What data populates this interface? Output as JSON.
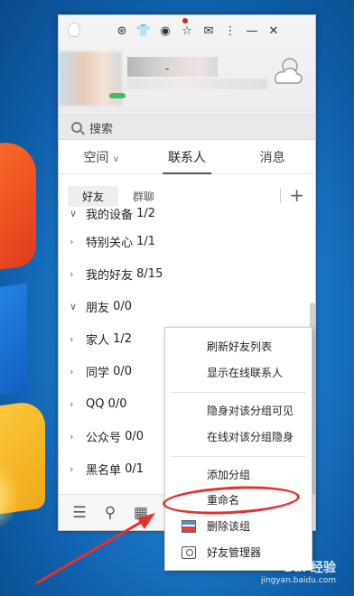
{
  "titlebar": {
    "icons": [
      "qq-logo-icon",
      "skin-icon",
      "shirt-icon",
      "app-icon",
      "star-icon",
      "mail-icon",
      "more-icon",
      "minimize-icon",
      "close-icon"
    ],
    "more_label": "⋮",
    "minimize_label": "—",
    "close_label": "✕"
  },
  "header": {
    "dash": "-"
  },
  "search": {
    "placeholder": "搜索"
  },
  "main_tabs": [
    {
      "label": "空间",
      "dropdown": true
    },
    {
      "label": "联系人",
      "active": true
    },
    {
      "label": "消息"
    }
  ],
  "sub_tabs": [
    {
      "label": "好友",
      "active": true
    },
    {
      "label": "群聊"
    }
  ],
  "add_label": "+",
  "groups": [
    {
      "name": "我的设备",
      "count": "1/2"
    },
    {
      "name": "特别关心",
      "count": "1/1"
    },
    {
      "name": "我的好友",
      "count": "8/15"
    },
    {
      "name": "朋友",
      "count": "0/0",
      "expanded": true
    },
    {
      "name": "家人",
      "count": "1/2"
    },
    {
      "name": "同学",
      "count": "0/0"
    },
    {
      "name": "QQ",
      "count": "0/0"
    },
    {
      "name": "公众号",
      "count": "0/0"
    },
    {
      "name": "黑名单",
      "count": "0/1"
    }
  ],
  "context_menu": {
    "refresh": "刷新好友列表",
    "show_online": "显示在线联系人",
    "invisible_visible": "隐身对该分组可见",
    "online_invisible": "在线对该分组隐身",
    "add_group": "添加分组",
    "rename": "重命名",
    "delete_group": "删除该组",
    "friend_manager": "好友管理器"
  },
  "bottom_bar": {
    "menu_label": "☰",
    "add_friend_label": "⚲",
    "apps_label": "▦"
  },
  "watermark": {
    "line1": "Bai 经验",
    "line2": "jingyan.baidu.com"
  },
  "colors": {
    "highlight": "#e53030",
    "online": "#3cbf60"
  }
}
